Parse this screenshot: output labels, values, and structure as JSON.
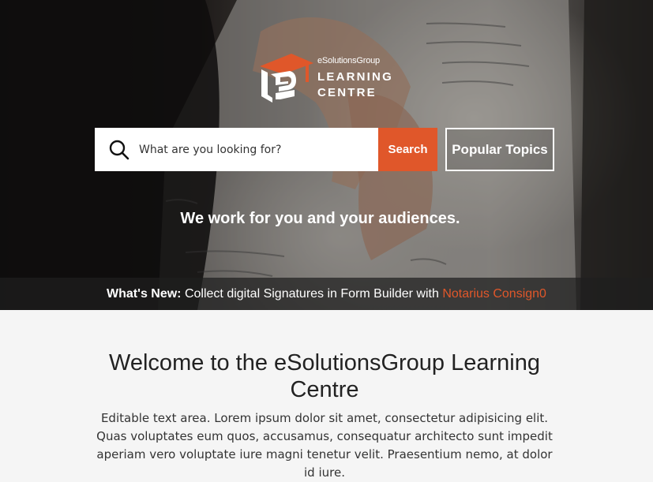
{
  "brand": {
    "name": "eSolutionsGroup",
    "title_line1": "LEARNING",
    "title_line2": "CENTRE"
  },
  "search": {
    "placeholder": "What are you looking for?",
    "value": "",
    "button_label": "Search"
  },
  "popular_topics_label": "Popular Topics",
  "tagline": "We work for you and your audiences.",
  "whats_new": {
    "label": "What's New:",
    "text": " Collect digital Signatures in Form Builder with ",
    "link_text": "Notarius Consign0"
  },
  "welcome": {
    "title": "Welcome to the eSolutionsGroup Learning Centre",
    "body": "Editable text area. Lorem ipsum dolor sit amet, consectetur adipisicing elit. Quas voluptates eum quos, accusamus, consequatur architecto sunt impedit aperiam vero voluptate iure magni tenetur velit. Praesentium nemo, at dolor id iure."
  },
  "colors": {
    "accent": "#e0572a",
    "hero_overlay": "#1e1e1e",
    "page_background": "#f5f5f5",
    "heading_text": "#222222"
  },
  "icons": {
    "search": "search-icon",
    "logo": "graduation-cap-logo-icon"
  }
}
